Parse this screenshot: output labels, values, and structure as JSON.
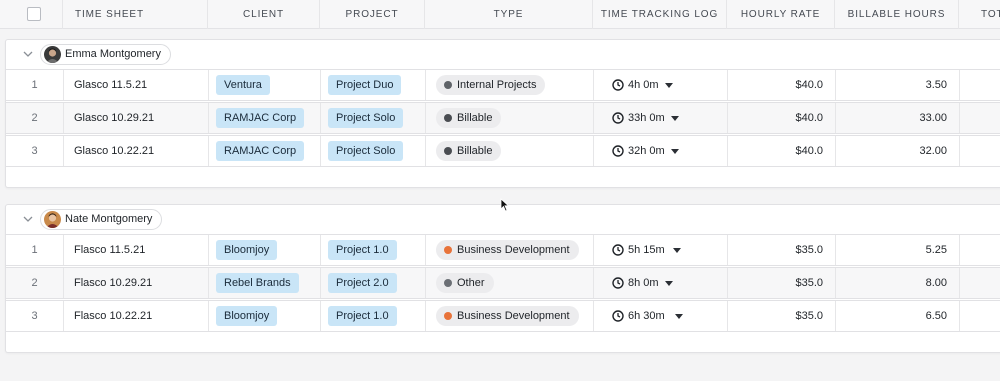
{
  "header": {
    "columns": [
      "TIME SHEET",
      "CLIENT",
      "PROJECT",
      "TYPE",
      "TIME TRACKING LOG",
      "HOURLY RATE",
      "BILLABLE HOURS",
      "TOT"
    ]
  },
  "colors": {
    "tag_bg": "#c9e5f7",
    "type_internal": "#5f6368",
    "type_billable": "#4a4d52",
    "type_business": "#e8733a",
    "type_other": "#6b6f75"
  },
  "groups": [
    {
      "user": "Emma Montgomery",
      "rows": [
        {
          "num": "1",
          "sheet": "Glasco 11.5.21",
          "client": "Ventura",
          "project": "Project Duo",
          "type": "Internal Projects",
          "type_color": "#5f6368",
          "log": "4h 0m",
          "rate": "$40.0",
          "hours": "3.50"
        },
        {
          "num": "2",
          "sheet": "Glasco 10.29.21",
          "client": "RAMJAC Corp",
          "project": "Project Solo",
          "type": "Billable",
          "type_color": "#4a4d52",
          "log": "33h 0m",
          "rate": "$40.0",
          "hours": "33.00"
        },
        {
          "num": "3",
          "sheet": "Glasco 10.22.21",
          "client": "RAMJAC Corp",
          "project": "Project Solo",
          "type": "Billable",
          "type_color": "#4a4d52",
          "log": "32h 0m",
          "rate": "$40.0",
          "hours": "32.00"
        }
      ]
    },
    {
      "user": "Nate Montgomery",
      "rows": [
        {
          "num": "1",
          "sheet": "Flasco 11.5.21",
          "client": "Bloomjoy",
          "project": "Project 1.0",
          "type": "Business Development",
          "type_color": "#e8733a",
          "log": "5h 15m",
          "rate": "$35.0",
          "hours": "5.25"
        },
        {
          "num": "2",
          "sheet": "Flasco 10.29.21",
          "client": "Rebel Brands",
          "project": "Project 2.0",
          "type": "Other",
          "type_color": "#6b6f75",
          "log": "8h 0m",
          "rate": "$35.0",
          "hours": "8.00"
        },
        {
          "num": "3",
          "sheet": "Flasco 10.22.21",
          "client": "Bloomjoy",
          "project": "Project 1.0",
          "type": "Business Development",
          "type_color": "#e8733a",
          "log": "6h 30m",
          "rate": "$35.0",
          "hours": "6.50"
        }
      ]
    }
  ]
}
